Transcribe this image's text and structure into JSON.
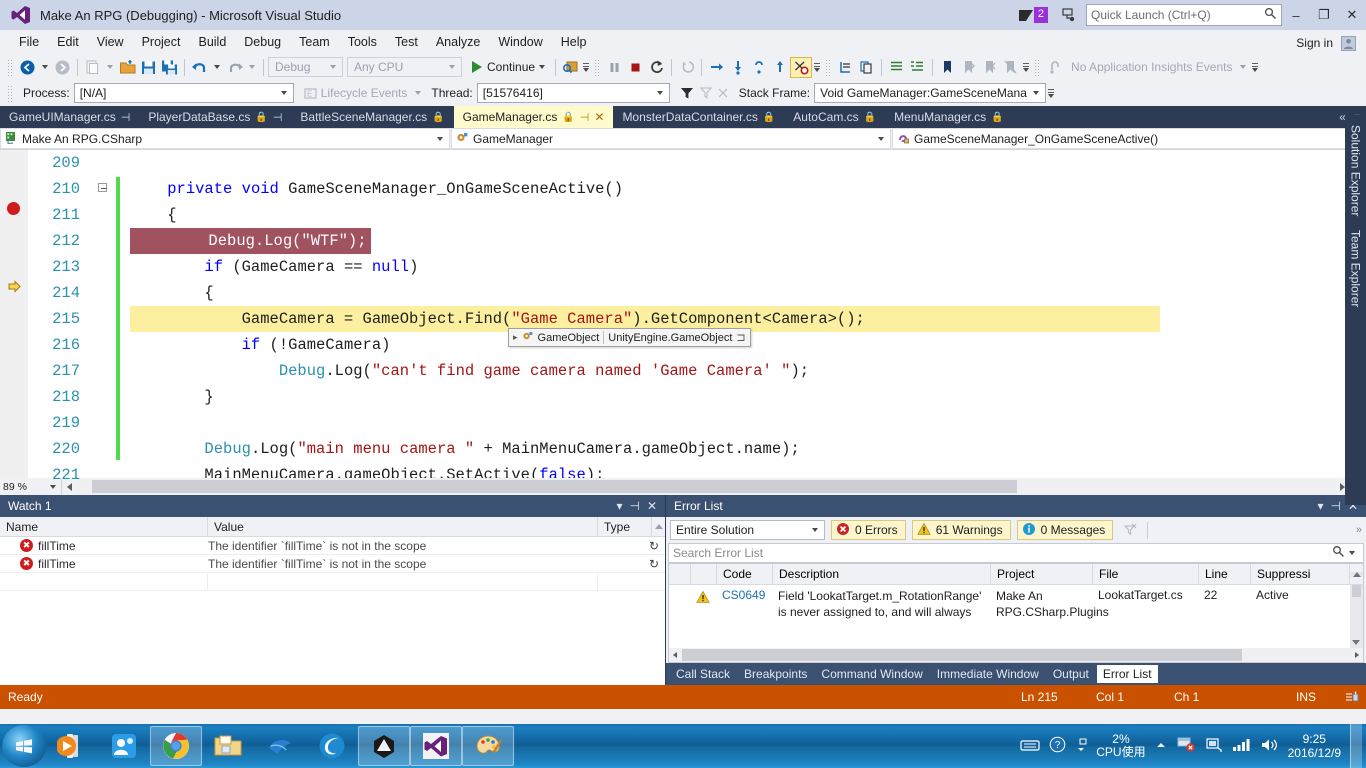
{
  "window": {
    "title": "Make An RPG (Debugging) - Microsoft Visual Studio",
    "logo_icon": "visual-studio-logo",
    "feedback_icon": "send-feedback-icon",
    "notification_icon": "notification-flag-icon",
    "notification_count": "2",
    "minimize": "–",
    "restore": "❐",
    "close": "✕",
    "sign_in": "Sign in",
    "account_icon": "user-account-icon"
  },
  "quick_launch": {
    "placeholder": "Quick Launch (Ctrl+Q)",
    "icon": "search-icon"
  },
  "menu": {
    "items": [
      "File",
      "Edit",
      "View",
      "Project",
      "Build",
      "Debug",
      "Team",
      "Tools",
      "Test",
      "Analyze",
      "Window",
      "Help"
    ]
  },
  "toolbar1": {
    "nav_back_icon": "navigate-back-icon",
    "nav_forward_icon": "navigate-forward-icon",
    "new_item_icon": "new-item-icon",
    "open_icon": "open-file-icon",
    "save_icon": "save-icon",
    "save_all_icon": "save-all-icon",
    "undo_icon": "undo-icon",
    "redo_icon": "redo-icon",
    "config": "Debug",
    "platform": "Any CPU",
    "continue_label": "Continue",
    "continue_icon": "play-icon",
    "attach_icon": "attach-to-process-icon",
    "break_all_icon": "break-all-icon",
    "stop_icon": "stop-debugging-icon",
    "restart_icon": "restart-icon",
    "show_next_statement_icon": "show-next-statement-icon",
    "step_over_icon": "step-over-icon",
    "step_into_icon": "step-into-icon",
    "step_out_icon": "step-out-icon",
    "no_breakpoints_icon": "disable-all-breakpoints-icon",
    "comment_icon": "comment-selection-icon",
    "uncomment_icon": "uncomment-selection-icon",
    "indent_icon": "decrease-indent-icon",
    "outdent_icon": "increase-indent-icon",
    "bookmark_icon": "toggle-bookmark-icon",
    "prev_bookmark_icon": "previous-bookmark-icon",
    "next_bookmark_icon": "next-bookmark-icon",
    "clear_bookmarks_icon": "clear-bookmarks-icon",
    "app_insights": "No Application Insights Events",
    "app_insights_icon": "application-insights-icon"
  },
  "toolbar2": {
    "process_label": "Process:",
    "process_value": "[N/A]",
    "lifecycle_label": "Lifecycle Events",
    "lifecycle_icon": "lifecycle-events-icon",
    "thread_label": "Thread:",
    "thread_value": "[51576416]",
    "filter_icon": "filter-icon",
    "flag_icon": "flag-thread-icon",
    "unflag_icon": "unflag-icon",
    "stack_frame_label": "Stack Frame:",
    "stack_frame_value": "Void GameManager:GameSceneMana"
  },
  "document_tabs": {
    "tabs": [
      {
        "label": "GameUIManager.cs",
        "locked": false,
        "pinned": true,
        "active": false
      },
      {
        "label": "PlayerDataBase.cs",
        "locked": true,
        "pinned": true,
        "active": false
      },
      {
        "label": "BattleSceneManager.cs",
        "locked": true,
        "pinned": false,
        "active": false
      },
      {
        "label": "GameManager.cs",
        "locked": true,
        "pinned": true,
        "active": true
      },
      {
        "label": "MonsterDataContainer.cs",
        "locked": true,
        "pinned": false,
        "active": false
      },
      {
        "label": "AutoCam.cs",
        "locked": true,
        "pinned": false,
        "active": false
      },
      {
        "label": "MenuManager.cs",
        "locked": true,
        "pinned": false,
        "active": false
      }
    ],
    "close_icon": "close-tab-icon",
    "overflow_icon": "tab-overflow-chevrons",
    "dropdown_icon": "active-files-dropdown-icon"
  },
  "nav_bar": {
    "project": "Make An RPG.CSharp",
    "project_icon": "csharp-project-icon",
    "type": "GameManager",
    "type_icon": "class-icon",
    "member": "GameSceneManager_OnGameSceneActive()",
    "member_icon": "private-method-icon"
  },
  "editor": {
    "zoom": "89 %",
    "lines": [
      {
        "num": "209",
        "segments": []
      },
      {
        "num": "210",
        "segments": [
          {
            "t": "    ",
            "c": "pln"
          },
          {
            "t": "private",
            "c": "kw"
          },
          {
            "t": " ",
            "c": "pln"
          },
          {
            "t": "void",
            "c": "kw"
          },
          {
            "t": " GameSceneManager_OnGameSceneActive()",
            "c": "pln"
          }
        ]
      },
      {
        "num": "211",
        "segments": [
          {
            "t": "    {",
            "c": "pln"
          }
        ]
      },
      {
        "num": "212",
        "segments": [
          {
            "t": "        Debug.Log(\"WTF\");",
            "c": "pln"
          }
        ],
        "breakpoint": true
      },
      {
        "num": "213",
        "segments": [
          {
            "t": "        ",
            "c": "pln"
          },
          {
            "t": "if",
            "c": "kw"
          },
          {
            "t": " (GameCamera == ",
            "c": "pln"
          },
          {
            "t": "null",
            "c": "kw"
          },
          {
            "t": ")",
            "c": "pln"
          }
        ]
      },
      {
        "num": "214",
        "segments": [
          {
            "t": "        {",
            "c": "pln"
          }
        ]
      },
      {
        "num": "215",
        "segments": [
          {
            "t": "            GameCamera = GameObject.Find(",
            "c": "pln"
          },
          {
            "t": "\"Game Camera\"",
            "c": "str"
          },
          {
            "t": ").GetComponent<Camera>();",
            "c": "pln"
          }
        ],
        "current": true
      },
      {
        "num": "216",
        "segments": [
          {
            "t": "            ",
            "c": "pln"
          },
          {
            "t": "if",
            "c": "kw"
          },
          {
            "t": " (!GameCamera)",
            "c": "pln"
          }
        ]
      },
      {
        "num": "217",
        "segments": [
          {
            "t": "                ",
            "c": "pln"
          },
          {
            "t": "Debug",
            "c": "cls"
          },
          {
            "t": ".Log(",
            "c": "pln"
          },
          {
            "t": "\"can't find game camera named 'Game Camera' \"",
            "c": "str"
          },
          {
            "t": ");",
            "c": "pln"
          }
        ]
      },
      {
        "num": "218",
        "segments": [
          {
            "t": "        }",
            "c": "pln"
          }
        ]
      },
      {
        "num": "219",
        "segments": []
      },
      {
        "num": "220",
        "segments": [
          {
            "t": "        ",
            "c": "pln"
          },
          {
            "t": "Debug",
            "c": "cls"
          },
          {
            "t": ".Log(",
            "c": "pln"
          },
          {
            "t": "\"main menu camera \"",
            "c": "str"
          },
          {
            "t": " + MainMenuCamera.gameObject.name);",
            "c": "pln"
          }
        ]
      },
      {
        "num": "221",
        "segments": [
          {
            "t": "        MainMenuCamera.gameObject.SetActive(",
            "c": "pln"
          },
          {
            "t": "false",
            "c": "kw"
          },
          {
            "t": ");",
            "c": "pln"
          }
        ]
      }
    ],
    "tooltip": {
      "icon": "class-member-icon",
      "expander": "▸",
      "name": "GameObject",
      "type": "UnityEngine.GameObject",
      "pin_icon": "pin-tooltip-icon"
    },
    "breakpoint_icon": "breakpoint-icon",
    "current_line_icon": "current-statement-arrow-icon"
  },
  "watch_panel": {
    "title": "Watch 1",
    "dropdown_icon": "window-menu-icon",
    "pin_icon": "auto-hide-pin-icon",
    "close_icon": "close-icon",
    "columns": [
      "Name",
      "Value",
      "Type"
    ],
    "rows": [
      {
        "icon": "error-value-icon",
        "name": "fillTime",
        "value": "The identifier `fillTime` is not in the scope",
        "type": "",
        "refresh_icon": "refresh-icon"
      },
      {
        "icon": "error-value-icon",
        "name": "fillTime",
        "value": "The identifier `fillTime` is not in the scope",
        "type": "",
        "refresh_icon": "refresh-icon"
      }
    ]
  },
  "error_list": {
    "title": "Error List",
    "dropdown_icon": "window-menu-icon",
    "pin_icon": "auto-hide-pin-icon",
    "close_icon": "close-icon",
    "scope": "Entire Solution",
    "errors_chip": "0 Errors",
    "warnings_chip": "61 Warnings",
    "messages_chip": "0 Messages",
    "error_icon": "error-icon",
    "warning_icon": "warning-icon",
    "info_icon": "information-icon",
    "filter_icon": "clear-filter-icon",
    "search_placeholder": "Search Error List",
    "search_icon": "search-icon",
    "columns": [
      "",
      "",
      "Code",
      "Description",
      "Project",
      "File",
      "Line",
      "Suppressi"
    ],
    "rows": [
      {
        "severity_icon": "warning-icon",
        "code": "CS0649",
        "description": "Field 'LookatTarget.m_RotationRange' is never assigned to, and will always",
        "project": "Make An RPG.CSharp.Plugins",
        "file": "LookatTarget.cs",
        "line": "22",
        "suppression": "Active"
      }
    ],
    "bottom_tabs": [
      "Call Stack",
      "Breakpoints",
      "Command Window",
      "Immediate Window",
      "Output",
      "Error List"
    ],
    "active_bottom_tab": "Error List"
  },
  "tool_windows": {
    "vertical_tabs": [
      "Solution Explorer",
      "Team Explorer"
    ]
  },
  "status_bar": {
    "state": "Ready",
    "line": "Ln 215",
    "col": "Col 1",
    "ch": "Ch 1",
    "insert_mode": "INS",
    "publish_icon": "publish-icon"
  },
  "taskbar": {
    "start_icon": "windows-start-orb",
    "items": [
      {
        "icon": "media-player-icon",
        "framed": false
      },
      {
        "icon": "contacts-icon",
        "framed": false
      },
      {
        "icon": "google-chrome-icon",
        "framed": true
      },
      {
        "icon": "windows-explorer-icon",
        "framed": false
      },
      {
        "icon": "hummingbird-icon",
        "framed": false
      },
      {
        "icon": "browser-icon",
        "framed": false
      },
      {
        "icon": "unity-icon",
        "framed": true
      },
      {
        "icon": "visual-studio-icon",
        "framed": true
      },
      {
        "icon": "paint-icon",
        "framed": true
      }
    ],
    "tray": {
      "keyboard_icon": "keyboard-layout-icon",
      "help_icon": "help-icon",
      "expand_icon": "show-hidden-icons-icon",
      "cpu_value": "2%",
      "cpu_label": "CPU使用",
      "action_center_icon": "action-center-flag-icon",
      "network_icon": "network-icon",
      "signal_icon": "signal-bars-icon",
      "volume_icon": "volume-icon",
      "time": "9:25",
      "date": "2016/12/9"
    }
  },
  "colors": {
    "title_bar": "#ccd4e8",
    "accent_purple": "#68217a",
    "tab_strip": "#2d3b55",
    "active_tab": "#fffbcc",
    "status_bar_debug": "#ca5100",
    "breakpoint_red": "#d11b1b",
    "current_line_yellow": "#fcf0a0",
    "breakpoint_highlight": "#a0525f",
    "change_bar_green": "#4edb4e"
  }
}
